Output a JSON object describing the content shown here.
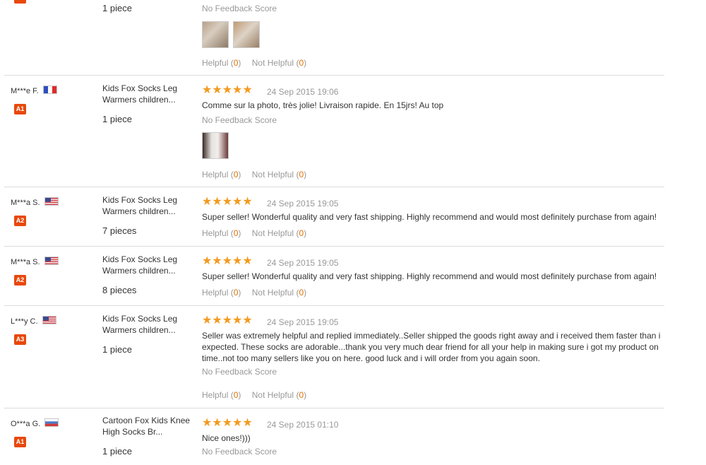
{
  "top_partial": {
    "qty": "1 piece",
    "feedback": "No Feedback Score",
    "helpful_label": "Helpful",
    "helpful_count": "0",
    "not_helpful_label": "Not Helpful",
    "not_helpful_count": "0"
  },
  "reviews": [
    {
      "user": "M***e F.",
      "flag": "france-flag-icon",
      "level": "A1",
      "product": "Kids Fox Socks Leg Warmers children...",
      "qty": "1 piece",
      "stars": "★★★★★",
      "date": "24 Sep 2015 19:06",
      "text": "Comme sur la photo, très jolie! Livraison rapide. En 15jrs! Au top",
      "feedback": "No Feedback Score",
      "helpful_label": "Helpful",
      "helpful_count": "0",
      "not_helpful_label": "Not Helpful",
      "not_helpful_count": "0"
    },
    {
      "user": "M***a S.",
      "flag": "usa-flag-icon",
      "level": "A2",
      "product": "Kids Fox Socks Leg Warmers children...",
      "qty": "7 pieces",
      "stars": "★★★★★",
      "date": "24 Sep 2015 19:05",
      "text": "Super seller! Wonderful quality and very fast shipping. Highly recommend and would most definitely purchase from again!",
      "helpful_label": "Helpful",
      "helpful_count": "0",
      "not_helpful_label": "Not Helpful",
      "not_helpful_count": "0"
    },
    {
      "user": "M***a S.",
      "flag": "usa-flag-icon",
      "level": "A2",
      "product": "Kids Fox Socks Leg Warmers children...",
      "qty": "8 pieces",
      "stars": "★★★★★",
      "date": "24 Sep 2015 19:05",
      "text": "Super seller! Wonderful quality and very fast shipping. Highly recommend and would most definitely purchase from again!",
      "helpful_label": "Helpful",
      "helpful_count": "0",
      "not_helpful_label": "Not Helpful",
      "not_helpful_count": "0"
    },
    {
      "user": "L***y C.",
      "flag": "usa-flag-icon",
      "level": "A3",
      "product": "Kids Fox Socks Leg Warmers children...",
      "qty": "1 piece",
      "stars": "★★★★★",
      "date": "24 Sep 2015 19:05",
      "text": "Seller was extremely helpful and replied immediately..Seller shipped the goods right away and i received them faster than i expected. These socks are adorable...thank you very much dear friend for all your help in making sure i got my product on time..not too many sellers like you on here. good luck and i will order from you again soon.",
      "feedback": "No Feedback Score",
      "helpful_label": "Helpful",
      "helpful_count": "0",
      "not_helpful_label": "Not Helpful",
      "not_helpful_count": "0"
    },
    {
      "user": "O***a G.",
      "flag": "russia-flag-icon",
      "level": "A1",
      "product": "Cartoon Fox Kids Knee High Socks Br...",
      "qty": "1 piece",
      "stars": "★★★★★",
      "date": "24 Sep 2015 01:10",
      "text": "Nice ones!)))",
      "feedback": "No Feedback Score"
    }
  ],
  "colors": {
    "star": "#f39a1f",
    "badge": "#e8480c",
    "count": "#e07000"
  }
}
